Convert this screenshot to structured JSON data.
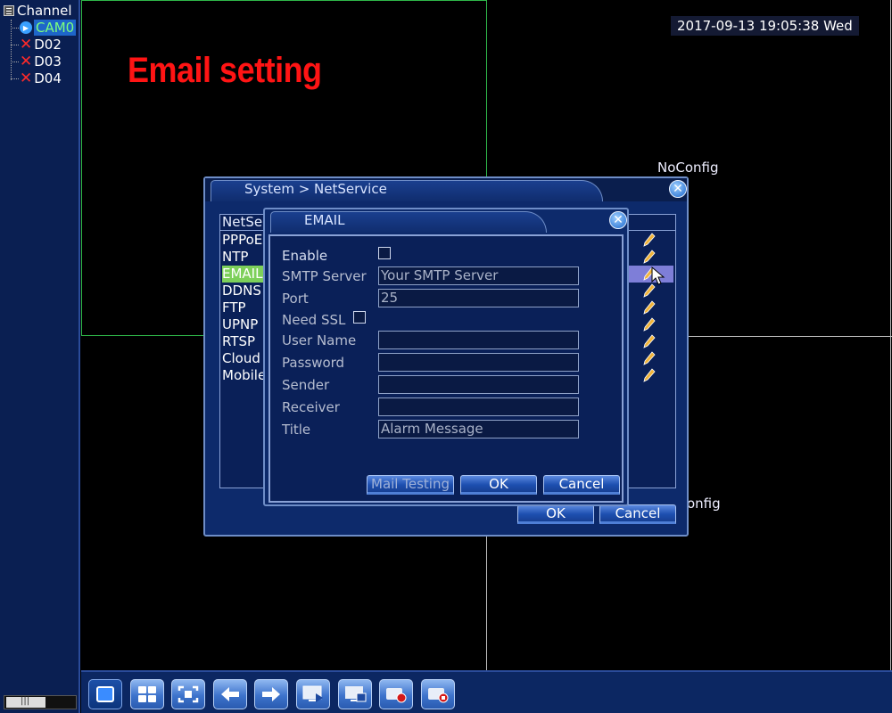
{
  "sidebar": {
    "title": "Channel",
    "channels": [
      {
        "label": "CAM0",
        "status": "playing",
        "selected": true
      },
      {
        "label": "D02",
        "status": "disconnected",
        "selected": false
      },
      {
        "label": "D03",
        "status": "disconnected",
        "selected": false
      },
      {
        "label": "D04",
        "status": "disconnected",
        "selected": false
      }
    ]
  },
  "datetime": "2017-09-13 19:05:38 Wed",
  "overlay_title": "Email setting",
  "noconfig_top": "NoConfig",
  "noconfig_bottom": "onfig",
  "netservice": {
    "title": "System > NetService",
    "header": "NetSe",
    "items": [
      "PPPoE",
      "NTP",
      "EMAIL",
      "DDNS",
      "FTP",
      "UPNP",
      "RTSP",
      "Cloud",
      "Mobile"
    ],
    "selected_index": 2,
    "ok_label": "OK",
    "cancel_label": "Cancel"
  },
  "email": {
    "title": "EMAIL",
    "enable_label": "Enable",
    "enable_checked": false,
    "smtp_label": "SMTP Server",
    "smtp_value": "Your SMTP Server",
    "port_label": "Port",
    "port_value": "25",
    "ssl_label": "Need SSL",
    "ssl_checked": false,
    "username_label": "User Name",
    "username_value": "",
    "password_label": "Password",
    "password_value": "",
    "sender_label": "Sender",
    "sender_value": "",
    "receiver_label": "Receiver",
    "receiver_value": "",
    "title_label": "Title",
    "title_value": "Alarm Message",
    "mail_testing_label": "Mail Testing",
    "ok_label": "OK",
    "cancel_label": "Cancel"
  },
  "toolbar": {
    "buttons": [
      "single-view",
      "quad-view",
      "fullscreen",
      "previous",
      "next",
      "preview",
      "tour",
      "record",
      "stop-record"
    ]
  },
  "colors": {
    "panel_bg": "#0d2a6b",
    "overlay_red": "#ff1414",
    "selected_green": "#7dd05a",
    "grid_green": "#2fb84a"
  }
}
